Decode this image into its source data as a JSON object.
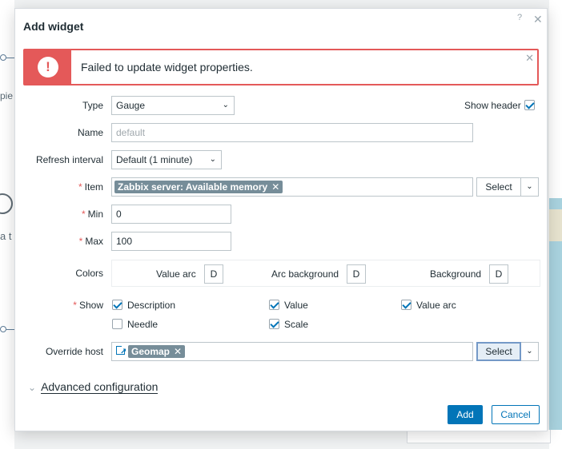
{
  "dialog": {
    "title": "Add widget",
    "help_icon": "?",
    "close_icon": "✕"
  },
  "error": {
    "message": "Failed to update widget properties.",
    "badge": "!",
    "close_icon": "✕"
  },
  "form": {
    "type": {
      "label": "Type",
      "value": "Gauge"
    },
    "show_header": {
      "label": "Show header",
      "checked": true
    },
    "name": {
      "label": "Name",
      "placeholder": "default"
    },
    "refresh": {
      "label": "Refresh interval",
      "value": "Default (1 minute)"
    },
    "item": {
      "label": "Item",
      "tag": "Zabbix server: Available memory",
      "select_label": "Select"
    },
    "min": {
      "label": "Min",
      "value": "0"
    },
    "max": {
      "label": "Max",
      "value": "100"
    },
    "colors": {
      "label": "Colors",
      "value_arc": "Value arc",
      "arc_background": "Arc background",
      "background": "Background",
      "default_letter": "D"
    },
    "show": {
      "label": "Show",
      "options": {
        "description": "Description",
        "value": "Value",
        "value_arc": "Value arc",
        "needle": "Needle",
        "scale": "Scale"
      }
    },
    "override_host": {
      "label": "Override host",
      "tag": "Geomap",
      "select_label": "Select"
    }
  },
  "advanced": {
    "label": "Advanced configuration"
  },
  "buttons": {
    "add": "Add",
    "cancel": "Cancel"
  },
  "background": {
    "text_a": "pie",
    "text_b": "a t"
  },
  "colors": {
    "error": "#e45959",
    "primary": "#0275b8",
    "tag": "#768d99"
  }
}
